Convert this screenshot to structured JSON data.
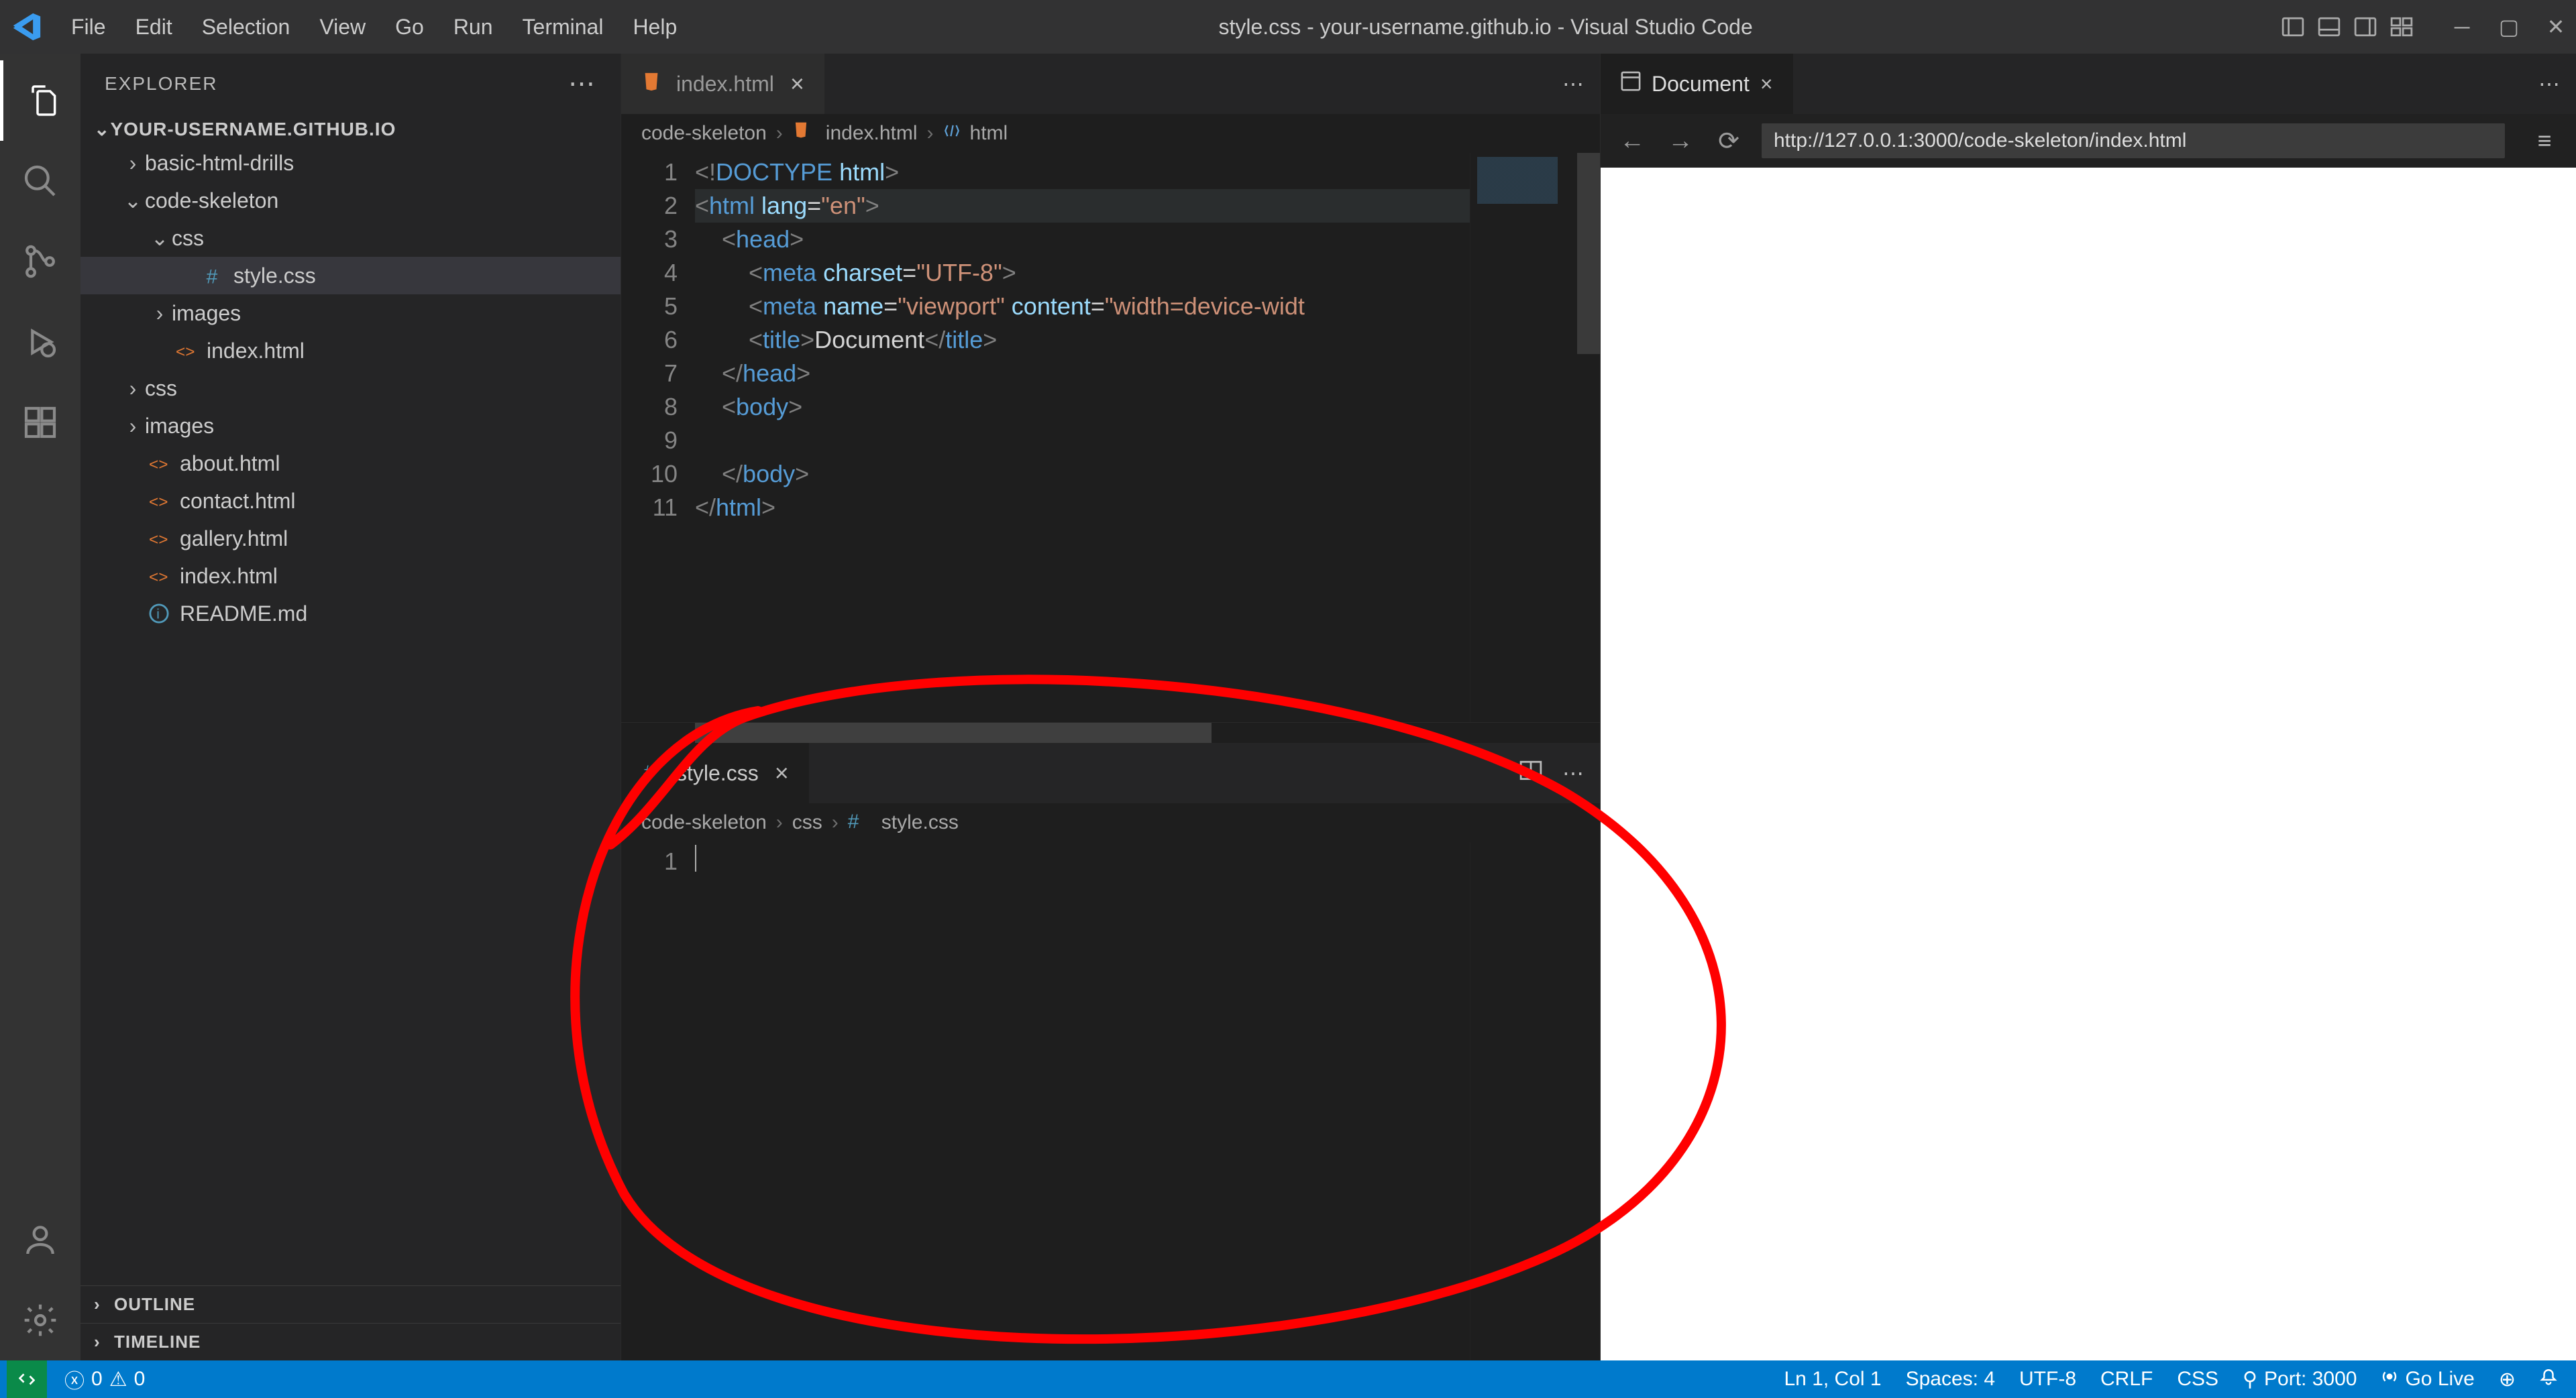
{
  "window_title": "style.css - your-username.github.io - Visual Studio Code",
  "menu": [
    "File",
    "Edit",
    "Selection",
    "View",
    "Go",
    "Run",
    "Terminal",
    "Help"
  ],
  "sidebar": {
    "title": "EXPLORER",
    "root": "YOUR-USERNAME.GITHUB.IO",
    "tree": [
      {
        "label": "basic-html-drills",
        "type": "folder",
        "expanded": false,
        "indent": 1
      },
      {
        "label": "code-skeleton",
        "type": "folder",
        "expanded": true,
        "indent": 1
      },
      {
        "label": "css",
        "type": "folder",
        "expanded": true,
        "indent": 2
      },
      {
        "label": "style.css",
        "type": "css",
        "indent": 3,
        "active": true
      },
      {
        "label": "images",
        "type": "folder",
        "expanded": false,
        "indent": 2
      },
      {
        "label": "index.html",
        "type": "html",
        "indent": 2
      },
      {
        "label": "css",
        "type": "folder",
        "expanded": false,
        "indent": 1
      },
      {
        "label": "images",
        "type": "folder",
        "expanded": false,
        "indent": 1
      },
      {
        "label": "about.html",
        "type": "html",
        "indent": 1
      },
      {
        "label": "contact.html",
        "type": "html",
        "indent": 1
      },
      {
        "label": "gallery.html",
        "type": "html",
        "indent": 1
      },
      {
        "label": "index.html",
        "type": "html",
        "indent": 1
      },
      {
        "label": "README.md",
        "type": "info",
        "indent": 1
      }
    ],
    "sections": [
      "OUTLINE",
      "TIMELINE"
    ]
  },
  "editor_top": {
    "tab": "index.html",
    "breadcrumbs": [
      "code-skeleton",
      "index.html",
      "html"
    ],
    "lines": [
      "1",
      "2",
      "3",
      "4",
      "5",
      "6",
      "7",
      "8",
      "9",
      "10",
      "11"
    ],
    "code_tokens": [
      [
        {
          "t": "<!",
          "c": "punc"
        },
        {
          "t": "DOCTYPE",
          "c": "doctype"
        },
        {
          "t": " html",
          "c": "attr"
        },
        {
          "t": ">",
          "c": "punc"
        }
      ],
      [
        {
          "t": "<",
          "c": "punc"
        },
        {
          "t": "html",
          "c": "tag"
        },
        {
          "t": " lang",
          "c": "attr"
        },
        {
          "t": "=",
          "c": "txt"
        },
        {
          "t": "\"en\"",
          "c": "str"
        },
        {
          "t": ">",
          "c": "punc"
        }
      ],
      [
        {
          "t": "    <",
          "c": "punc"
        },
        {
          "t": "head",
          "c": "tag"
        },
        {
          "t": ">",
          "c": "punc"
        }
      ],
      [
        {
          "t": "        <",
          "c": "punc"
        },
        {
          "t": "meta",
          "c": "tag"
        },
        {
          "t": " charset",
          "c": "attr"
        },
        {
          "t": "=",
          "c": "txt"
        },
        {
          "t": "\"UTF-8\"",
          "c": "str"
        },
        {
          "t": ">",
          "c": "punc"
        }
      ],
      [
        {
          "t": "        <",
          "c": "punc"
        },
        {
          "t": "meta",
          "c": "tag"
        },
        {
          "t": " name",
          "c": "attr"
        },
        {
          "t": "=",
          "c": "txt"
        },
        {
          "t": "\"viewport\"",
          "c": "str"
        },
        {
          "t": " content",
          "c": "attr"
        },
        {
          "t": "=",
          "c": "txt"
        },
        {
          "t": "\"width=device-widt",
          "c": "str"
        }
      ],
      [
        {
          "t": "        <",
          "c": "punc"
        },
        {
          "t": "title",
          "c": "tag"
        },
        {
          "t": ">",
          "c": "punc"
        },
        {
          "t": "Document",
          "c": "txt"
        },
        {
          "t": "</",
          "c": "punc"
        },
        {
          "t": "title",
          "c": "tag"
        },
        {
          "t": ">",
          "c": "punc"
        }
      ],
      [
        {
          "t": "    </",
          "c": "punc"
        },
        {
          "t": "head",
          "c": "tag"
        },
        {
          "t": ">",
          "c": "punc"
        }
      ],
      [
        {
          "t": "    <",
          "c": "punc"
        },
        {
          "t": "body",
          "c": "tag"
        },
        {
          "t": ">",
          "c": "punc"
        }
      ],
      [
        {
          "t": "",
          "c": "txt"
        }
      ],
      [
        {
          "t": "    </",
          "c": "punc"
        },
        {
          "t": "body",
          "c": "tag"
        },
        {
          "t": ">",
          "c": "punc"
        }
      ],
      [
        {
          "t": "</",
          "c": "punc"
        },
        {
          "t": "html",
          "c": "tag"
        },
        {
          "t": ">",
          "c": "punc"
        }
      ]
    ],
    "highlight_line_index": 1
  },
  "editor_bottom": {
    "tab": "style.css",
    "breadcrumbs": [
      "code-skeleton",
      "css",
      "style.css"
    ],
    "lines": [
      "1"
    ]
  },
  "preview": {
    "tab": "Document",
    "url": "http://127.0.0.1:3000/code-skeleton/index.html"
  },
  "status": {
    "errors": "0",
    "warnings": "0",
    "cursor": "Ln 1, Col 1",
    "spaces": "Spaces: 4",
    "encoding": "UTF-8",
    "eol": "CRLF",
    "lang": "CSS",
    "port": "Port: 3000",
    "golive": "Go Live"
  }
}
